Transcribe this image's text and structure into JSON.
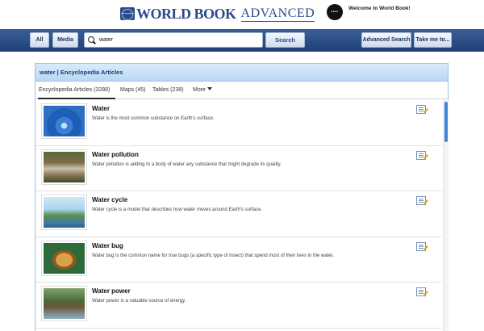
{
  "header": {
    "logo_main": "WORLD BOOK",
    "logo_sub": "ADVANCED",
    "avatar_text": "••••",
    "welcome": "Welcome to World Book!"
  },
  "searchbar": {
    "all_label": "All",
    "media_label": "Media",
    "query": "water",
    "search_label": "Search",
    "advanced_label": "Advanced Search",
    "take_me_label": "Take me to..."
  },
  "panel": {
    "title": "water | Encyclopedia Articles",
    "tabs": [
      {
        "label": "Encyclopedia Articles (3288)"
      },
      {
        "label": "Maps (45)"
      },
      {
        "label": "Tables (238)"
      },
      {
        "label": "More"
      }
    ],
    "results": [
      {
        "title": "Water",
        "desc": "Water is the most common substance on Earth's surface."
      },
      {
        "title": "Water pollution",
        "desc": "Water pollution is adding to a body of water any substance that might degrade its quality."
      },
      {
        "title": "Water cycle",
        "desc": "Water cycle is a model that describes how water moves around Earth's surface."
      },
      {
        "title": "Water bug",
        "desc": "Water bug is the common name for true bugs (a specific type of insect) that spend most of their lives in the water."
      },
      {
        "title": "Water power",
        "desc": "Water power is a valuable source of energy."
      }
    ]
  },
  "colors": {
    "brand": "#2b4a8c",
    "bar_top": "#3a5f98",
    "bar_bottom": "#203f74",
    "panel_header": "#c9e1f7",
    "scroll_thumb": "#3f83d6"
  }
}
